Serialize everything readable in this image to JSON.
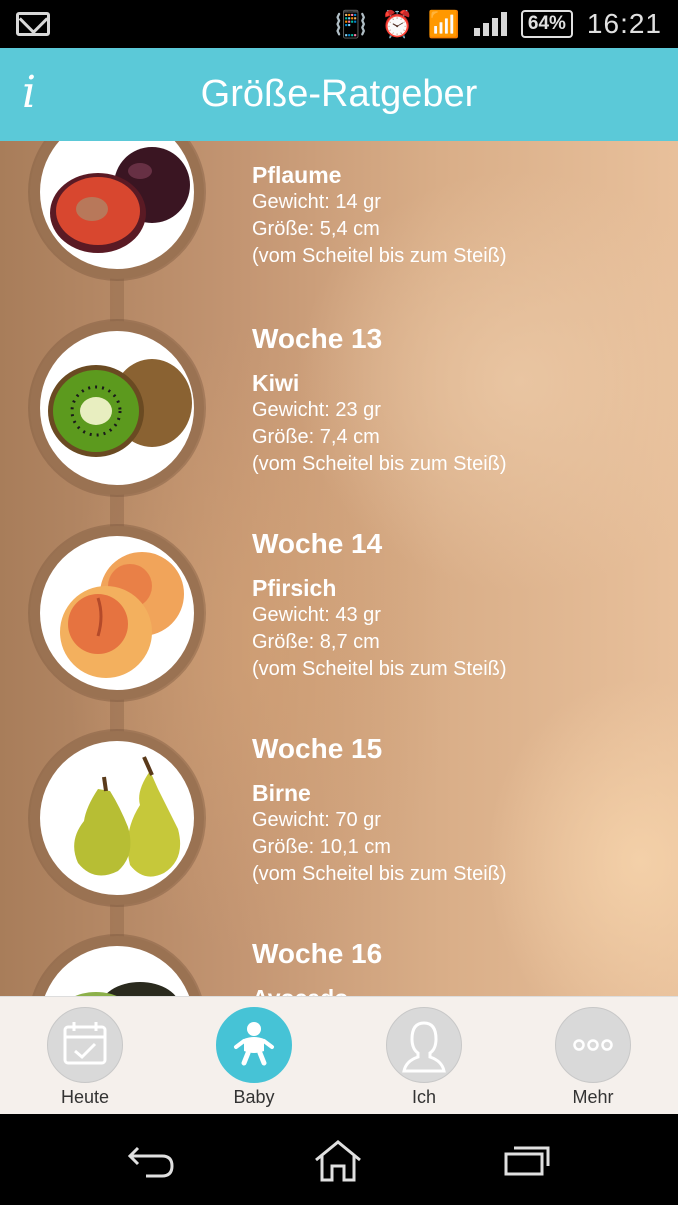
{
  "status": {
    "battery": "64%",
    "time": "16:21"
  },
  "header": {
    "info_label": "i",
    "title": "Größe-Ratgeber"
  },
  "entries": [
    {
      "week": "",
      "fruit": "Pflaume",
      "weight": "Gewicht: 14 gr",
      "size": "Größe: 5,4 cm",
      "note": "(vom Scheitel bis zum Steiß)"
    },
    {
      "week": "Woche 13",
      "fruit": "Kiwi",
      "weight": "Gewicht: 23 gr",
      "size": "Größe: 7,4 cm",
      "note": "(vom Scheitel bis zum Steiß)"
    },
    {
      "week": "Woche 14",
      "fruit": "Pfirsich",
      "weight": "Gewicht: 43 gr",
      "size": "Größe: 8,7 cm",
      "note": "(vom Scheitel bis zum Steiß)"
    },
    {
      "week": "Woche 15",
      "fruit": "Birne",
      "weight": "Gewicht: 70 gr",
      "size": "Größe: 10,1 cm",
      "note": "(vom Scheitel bis zum Steiß)"
    },
    {
      "week": "Woche 16",
      "fruit": "Avocado",
      "weight": "",
      "size": "",
      "note": ""
    }
  ],
  "tabs": [
    {
      "label": "Heute",
      "icon": "calendar-icon"
    },
    {
      "label": "Baby",
      "icon": "baby-icon"
    },
    {
      "label": "Ich",
      "icon": "person-icon"
    },
    {
      "label": "Mehr",
      "icon": "more-icon"
    }
  ],
  "active_tab": "Baby",
  "colors": {
    "accent": "#5bc9d8",
    "active_tab": "#46c3d6"
  }
}
